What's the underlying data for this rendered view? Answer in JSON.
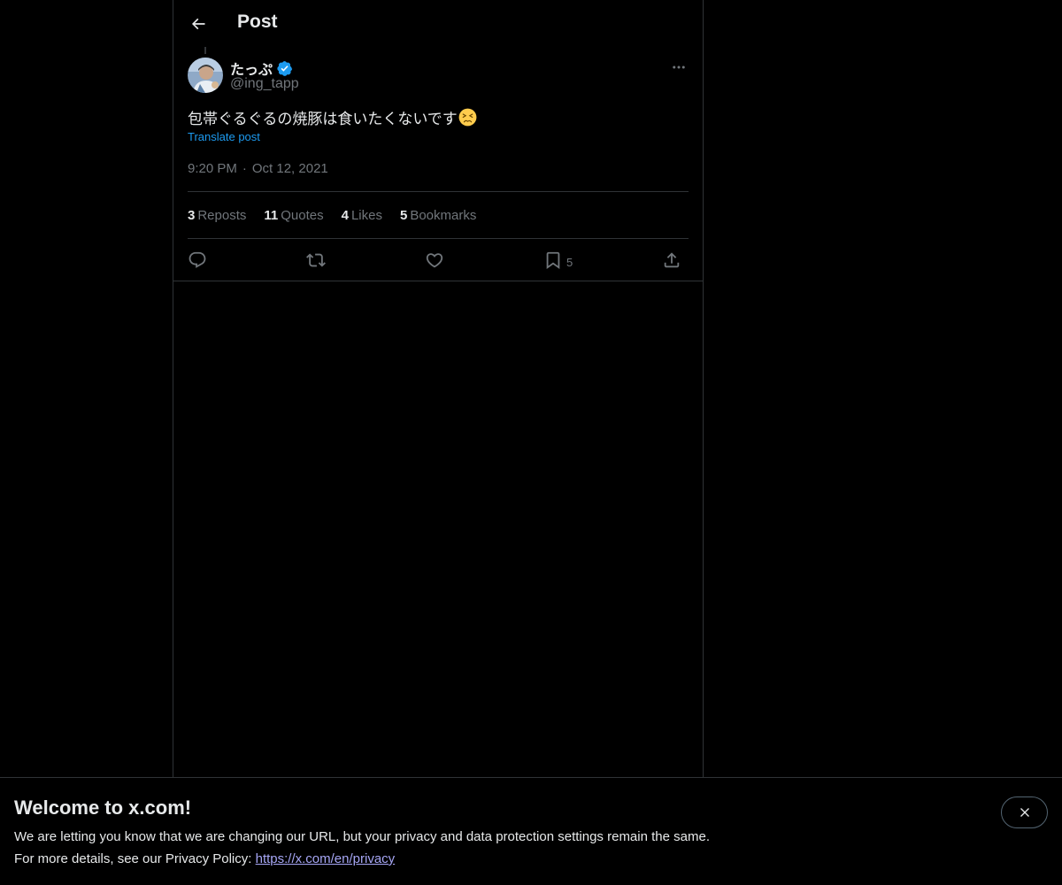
{
  "header": {
    "title": "Post",
    "back_icon": "arrow-left-icon"
  },
  "post": {
    "author": {
      "display_name": "たっぷ",
      "verified": true,
      "handle": "@ing_tapp"
    },
    "text": "包帯ぐるぐるの焼豚は食いたくないです",
    "emoji": "persevering-face-emoji",
    "translate_label": "Translate post",
    "time": "9:20 PM",
    "separator": "·",
    "date": "Oct 12, 2021",
    "stats": {
      "reposts_count": "3",
      "reposts_label": "Reposts",
      "quotes_count": "11",
      "quotes_label": "Quotes",
      "likes_count": "4",
      "likes_label": "Likes",
      "bookmarks_count": "5",
      "bookmarks_label": "Bookmarks"
    },
    "actions": {
      "reply_icon": "reply-icon",
      "repost_icon": "repost-icon",
      "like_icon": "heart-icon",
      "bookmark_icon": "bookmark-icon",
      "bookmark_count": "5",
      "share_icon": "share-icon"
    }
  },
  "banner": {
    "title": "Welcome to x.com!",
    "line1": "We are letting you know that we are changing our URL, but your privacy and data protection settings remain the same.",
    "line2_prefix": "For more details, see our Privacy Policy:",
    "link_text": "https://x.com/en/privacy",
    "close_icon": "close-icon"
  },
  "colors": {
    "background": "#000000",
    "text_primary": "#e7e9ea",
    "text_secondary": "#71767b",
    "accent": "#1d9bf0",
    "border": "#2f3336",
    "link_banner": "#a6a6f5"
  }
}
